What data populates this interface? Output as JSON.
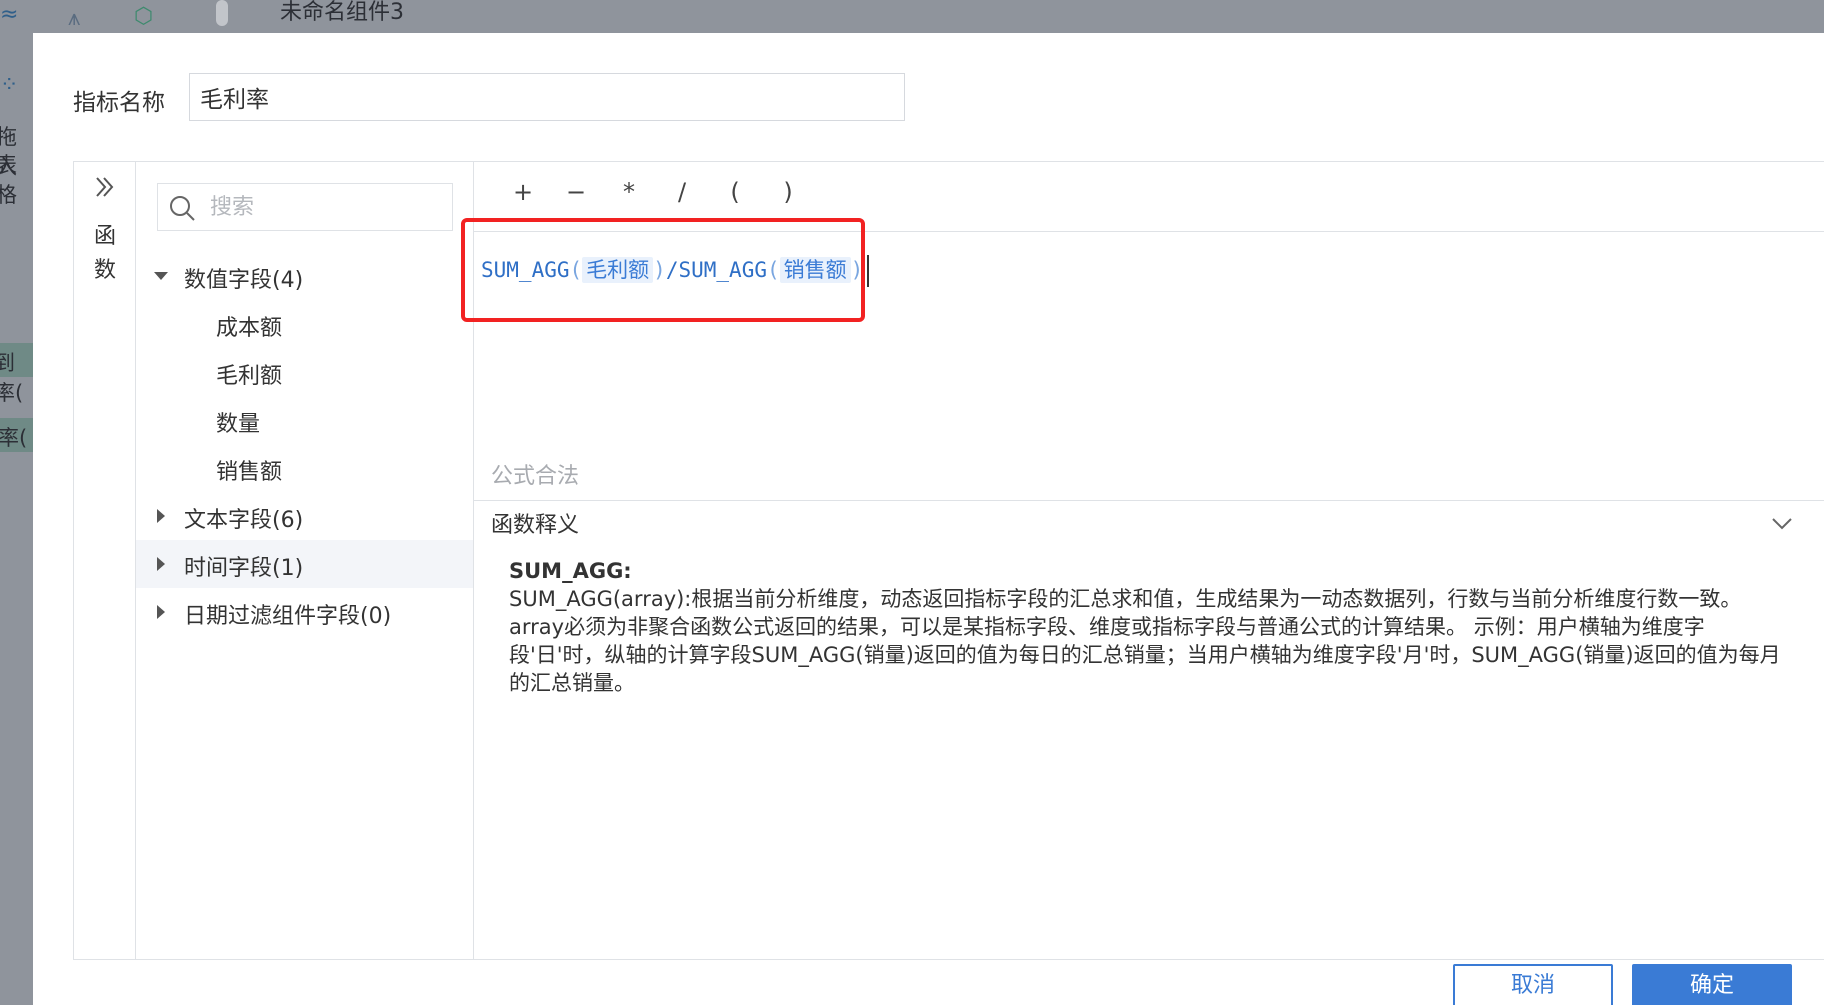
{
  "background": {
    "title": "未命名组件3",
    "frag_1": "拖入",
    "frag_2": "表格",
    "frag_3": "到率(",
    "frag_4": "率("
  },
  "dialog": {
    "name_label": "指标名称",
    "name_value": "毛利率",
    "functions_label": "函数",
    "search_placeholder": "搜索",
    "field_groups": [
      {
        "label": "数值字段(4)",
        "expanded": true,
        "items": [
          "成本额",
          "毛利额",
          "数量",
          "销售额"
        ]
      },
      {
        "label": "文本字段(6)",
        "expanded": false
      },
      {
        "label": "时间字段(1)",
        "expanded": false,
        "active": true
      },
      {
        "label": "日期过滤组件字段(0)",
        "expanded": false
      }
    ],
    "operators": [
      "+",
      "−",
      "*",
      "/",
      "(",
      ")"
    ],
    "formula": {
      "fn1": "SUM_AGG",
      "open1": "(",
      "field1": "毛利额",
      "close1": ")",
      "slash": "/",
      "fn2": "SUM_AGG",
      "open2": "(",
      "field2": "销售额",
      "close2": ")"
    },
    "validity": "公式合法",
    "explain": {
      "title": "函数释义",
      "function_name": "SUM_AGG:",
      "description": "SUM_AGG(array):根据当前分析维度，动态返回指标字段的汇总求和值，生成结果为一动态数据列，行数与当前分析维度行数一致。 array必须为非聚合函数公式返回的结果，可以是某指标字段、维度或指标字段与普通公式的计算结果。 示例：用户横轴为维度字段'日'时，纵轴的计算字段SUM_AGG(销量)返回的值为每日的汇总销量；当用户横轴为维度字段'月'时，SUM_AGG(销量)返回的值为每月的汇总销量。"
    },
    "cancel_label": "取消",
    "ok_label": "确定"
  },
  "colors": {
    "accent": "#3a7bd5",
    "highlight": "#f22222"
  }
}
